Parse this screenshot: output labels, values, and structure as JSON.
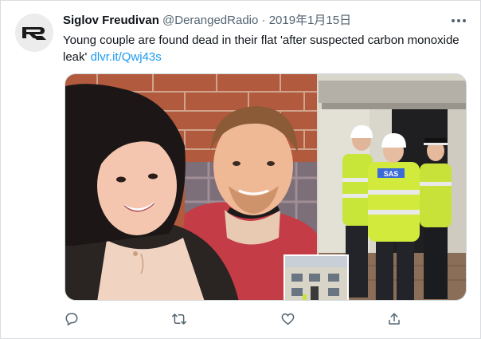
{
  "tweet": {
    "author_name": "Siglov Freudivan",
    "author_handle": "@DerangedRadio",
    "separator": "·",
    "date": "2019年1月15日",
    "text": "Young couple are found dead in their flat 'after suspected carbon monoxide leak'",
    "link_text": "dlvr.it/Qwj43s"
  },
  "media": {
    "vest_label": "SAS"
  },
  "actions": [
    {
      "icon": "reply-icon"
    },
    {
      "icon": "retweet-icon"
    },
    {
      "icon": "like-icon"
    },
    {
      "icon": "share-icon"
    }
  ],
  "colors": {
    "text": "#0f1419",
    "secondary": "#536471",
    "link": "#1d9bf0",
    "border": "#cfd9de"
  }
}
